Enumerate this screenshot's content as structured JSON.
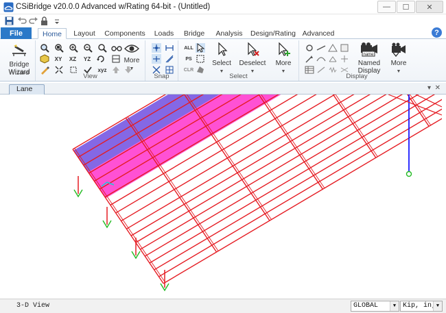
{
  "app": {
    "title": "CSiBridge v20.0.0 Advanced w/Rating 64-bit - (Untitled)"
  },
  "window_controls": {
    "minimize": "—",
    "maximize": "☐",
    "close": "✕"
  },
  "ribbon": {
    "file_label": "File",
    "tabs": [
      "Home",
      "Layout",
      "Components",
      "Loads",
      "Bridge",
      "Analysis",
      "Design/Rating",
      "Advanced"
    ],
    "active_tab": "Home",
    "help_label": "?",
    "groups": {
      "wizard": {
        "label": "Wizard",
        "button": "Bridge\nWizard"
      },
      "view": {
        "label": "View",
        "buttons": [
          "XY",
          "XZ",
          "YZ",
          "xyz"
        ],
        "more": "More"
      },
      "snap": {
        "label": "Snap"
      },
      "select": {
        "label": "Select",
        "small": [
          "ALL",
          "PS",
          "CLR"
        ],
        "select": "Select",
        "deselect": "Deselect",
        "more": "More"
      },
      "display": {
        "label": "Display",
        "named_display": "Named\nDisplay",
        "named_chip": "name",
        "more": "More"
      }
    }
  },
  "document": {
    "tab": "Lane",
    "pin": "▾",
    "close": "✕"
  },
  "status": {
    "view": "3-D View",
    "coord_system": "GLOBAL",
    "units": "Kip, in, F"
  },
  "colors": {
    "frame": "#e51c23",
    "lane_blue": "#6f4de0",
    "lane_magenta": "#ff33cc",
    "support": "#22bb22",
    "axis": "#1a1aff",
    "file_tab": "#2b79c8"
  }
}
